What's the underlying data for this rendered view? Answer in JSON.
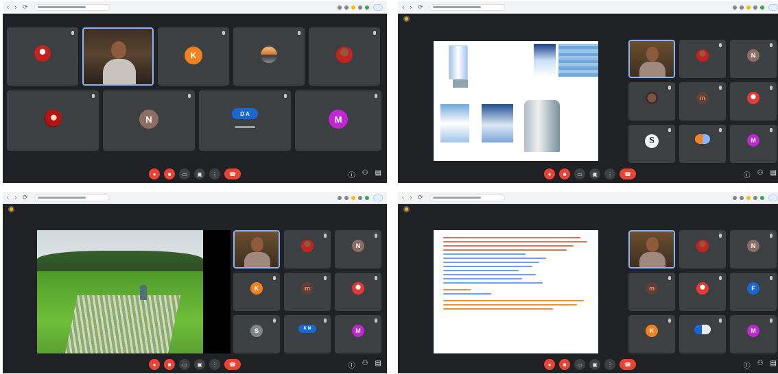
{
  "colors": {
    "background": "#202124",
    "tile": "#3c4043",
    "end_call": "#ea4335",
    "accent_blue": "#1a73e8"
  },
  "icons": [
    "mic-off-icon",
    "camera-off-icon",
    "captions-icon",
    "present-icon",
    "more-icon",
    "end-call-icon",
    "info-icon",
    "people-icon",
    "chat-icon",
    "pin-icon"
  ],
  "panel1": {
    "tiles": [
      {
        "initial": "",
        "color": "#c5221f"
      },
      {
        "initial": "",
        "color": "#6b4e2e"
      },
      {
        "initial": "K",
        "color": "#f4811f"
      },
      {
        "initial": "",
        "color": "#5f6368"
      },
      {
        "initial": "",
        "color": "#c5221f"
      },
      {
        "initial": "",
        "color": "#b31412"
      },
      {
        "initial": "N",
        "color": "#8d6e63"
      },
      {
        "initial": "D A",
        "color": "#1967d2"
      },
      {
        "initial": "M",
        "color": "#c026d3"
      }
    ]
  },
  "panel2": {
    "tiles": [
      {
        "initial": "",
        "color": "#6b4e2e"
      },
      {
        "initial": "",
        "color": "#c5221f"
      },
      {
        "initial": "N",
        "color": "#8d6e63"
      },
      {
        "initial": "",
        "color": "#795548"
      },
      {
        "initial": "m",
        "color": "#5d4037"
      },
      {
        "initial": "",
        "color": "#e53935"
      },
      {
        "initial": "S",
        "color": "#f1f3f4"
      },
      {
        "initial": "",
        "color": "#f4811f"
      },
      {
        "initial": "M",
        "color": "#c026d3"
      }
    ]
  },
  "panel3": {
    "tiles": [
      {
        "initial": "",
        "color": "#6b4e2e"
      },
      {
        "initial": "",
        "color": "#c5221f"
      },
      {
        "initial": "N",
        "color": "#8d6e63"
      },
      {
        "initial": "K",
        "color": "#f4811f"
      },
      {
        "initial": "m",
        "color": "#5d4037"
      },
      {
        "initial": "",
        "color": "#e53935"
      },
      {
        "initial": "S",
        "color": "#80868b"
      },
      {
        "initial": "K M",
        "color": "#1967d2"
      },
      {
        "initial": "M",
        "color": "#c026d3"
      }
    ]
  },
  "panel4": {
    "tiles": [
      {
        "initial": "",
        "color": "#6b4e2e"
      },
      {
        "initial": "",
        "color": "#c5221f"
      },
      {
        "initial": "N",
        "color": "#8d6e63"
      },
      {
        "initial": "m",
        "color": "#5d4037"
      },
      {
        "initial": "",
        "color": "#e53935"
      },
      {
        "initial": "F",
        "color": "#1967d2"
      },
      {
        "initial": "K",
        "color": "#f4811f"
      },
      {
        "initial": "",
        "color": "#1967d2"
      },
      {
        "initial": "M",
        "color": "#c026d3"
      }
    ]
  }
}
